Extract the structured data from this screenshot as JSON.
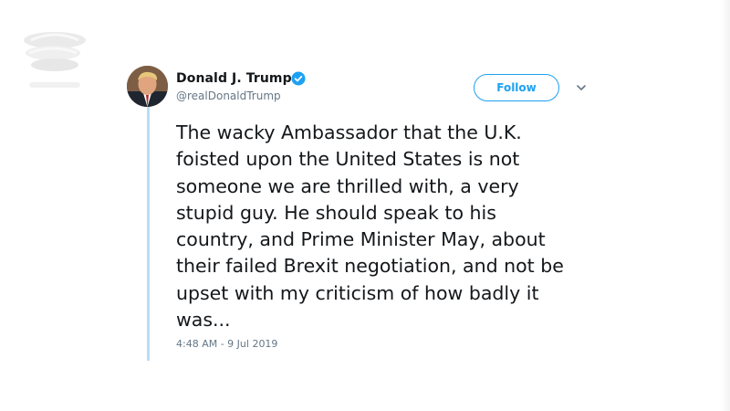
{
  "tweet": {
    "author_name": "Donald J. Trump",
    "handle": "@realDonaldTrump",
    "verified": true,
    "follow_label": "Follow",
    "text": "The wacky Ambassador that the U.K.\nfoisted upon the United States is not\nsomeone we are thrilled with, a very\nstupid guy. He should speak to his\ncountry, and Prime Minister May, about\ntheir failed Brexit negotiation, and not be\nupset with my criticism of how badly it\nwas...",
    "timestamp": "4:48 AM - 9 Jul 2019"
  },
  "icons": {
    "verified": "verified-badge-icon",
    "caret": "chevron-down-icon",
    "watermark": "news-agency-logo"
  },
  "colors": {
    "twitter_blue": "#1da1f2",
    "text": "#14171a",
    "secondary": "#657786",
    "thread_line": "#b7dff7"
  }
}
